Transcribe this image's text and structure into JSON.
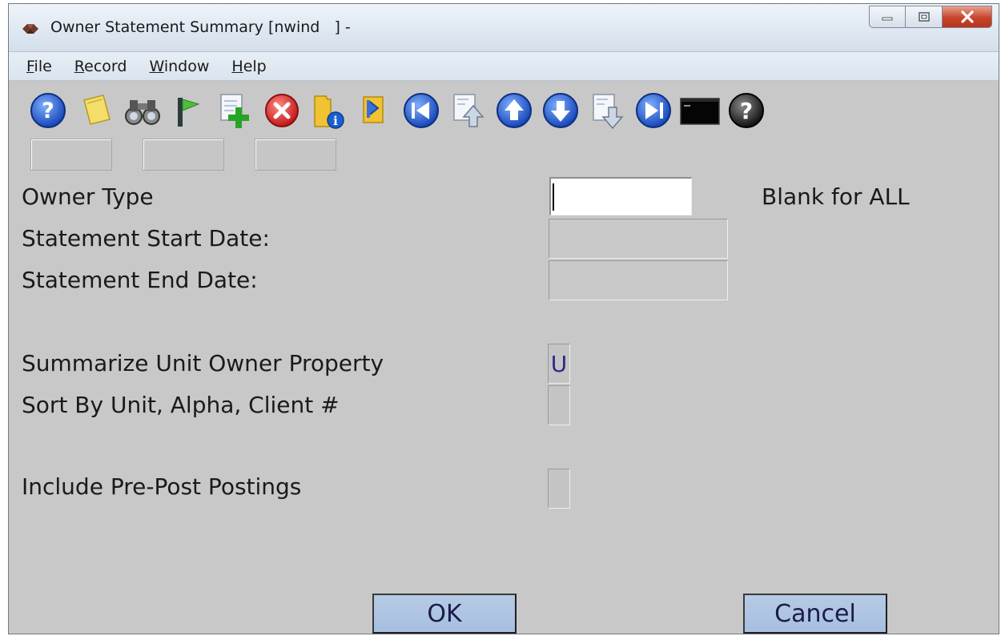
{
  "window": {
    "title": "Owner Statement Summary [nwind   ] -",
    "controls": [
      "minimize",
      "maximize",
      "close"
    ]
  },
  "menu": [
    {
      "label_underlined": "F",
      "label_rest": "ile"
    },
    {
      "label_underlined": "R",
      "label_rest": "ecord"
    },
    {
      "label_underlined": "W",
      "label_rest": "indow"
    },
    {
      "label_underlined": "H",
      "label_rest": "elp"
    }
  ],
  "toolbar": {
    "buttons": [
      {
        "icon": "help-icon"
      },
      {
        "icon": "note-icon"
      },
      {
        "icon": "binoculars-icon"
      },
      {
        "icon": "flag-icon"
      },
      {
        "icon": "add-record-icon"
      },
      {
        "icon": "delete-icon"
      },
      {
        "icon": "folder-info-icon"
      },
      {
        "icon": "export-icon"
      },
      {
        "icon": "first-record-icon"
      },
      {
        "icon": "page-up-icon"
      },
      {
        "icon": "previous-record-icon"
      },
      {
        "icon": "next-record-icon"
      },
      {
        "icon": "page-down-icon"
      },
      {
        "icon": "last-record-icon"
      },
      {
        "icon": "terminal-icon"
      },
      {
        "icon": "context-help-icon"
      }
    ]
  },
  "form": {
    "owner_type": {
      "label": "Owner Type",
      "value": "",
      "hint": "Blank for ALL"
    },
    "statement_start_date": {
      "label": "Statement Start Date:",
      "value": ""
    },
    "statement_end_date": {
      "label": "Statement End Date:",
      "value": ""
    },
    "summarize_unit_owner_property": {
      "label": "Summarize Unit Owner Property",
      "value": "U"
    },
    "sort_by": {
      "label": "Sort By Unit, Alpha, Client #",
      "value": ""
    },
    "include_pre_post": {
      "label": "Include Pre-Post Postings",
      "value": ""
    }
  },
  "buttons": {
    "ok": "OK",
    "cancel": "Cancel"
  },
  "colors": {
    "dialog_bg": "#c8c8c8",
    "button_bg": "#b0c6e2",
    "flag_text": "#2a2a86",
    "close_button": "#c7442b"
  }
}
